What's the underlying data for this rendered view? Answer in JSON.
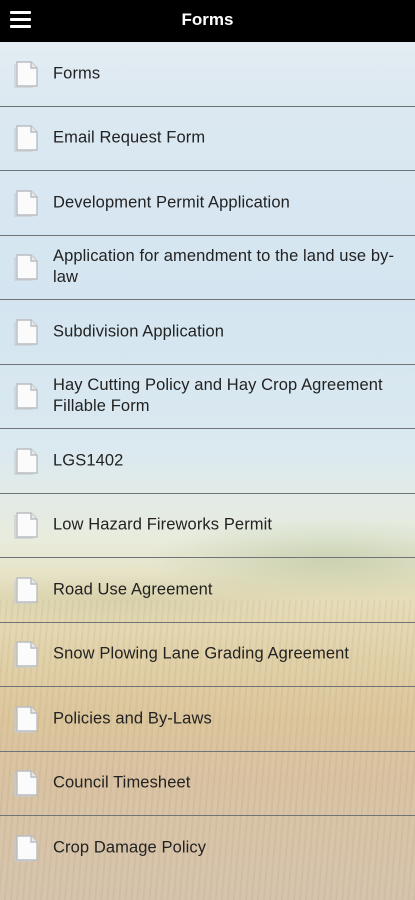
{
  "header": {
    "title": "Forms",
    "menu_icon": "hamburger-menu-icon"
  },
  "list": {
    "item_icon": "document-icon",
    "items": [
      {
        "label": "Forms"
      },
      {
        "label": "Email Request Form"
      },
      {
        "label": "Development Permit Application"
      },
      {
        "label": "Application for amendment to the land use by-law"
      },
      {
        "label": "Subdivision Application"
      },
      {
        "label": "Hay Cutting Policy and Hay Crop Agreement Fillable Form"
      },
      {
        "label": "LGS1402"
      },
      {
        "label": "Low Hazard Fireworks Permit"
      },
      {
        "label": "Road Use Agreement"
      },
      {
        "label": "Snow Plowing Lane Grading Agreement"
      },
      {
        "label": "Policies and By-Laws"
      },
      {
        "label": "Council Timesheet"
      },
      {
        "label": "Crop Damage Policy"
      }
    ]
  },
  "colors": {
    "header_bg": "#000000",
    "header_text": "#ffffff",
    "item_text": "#222222",
    "divider": "#6f7478"
  }
}
